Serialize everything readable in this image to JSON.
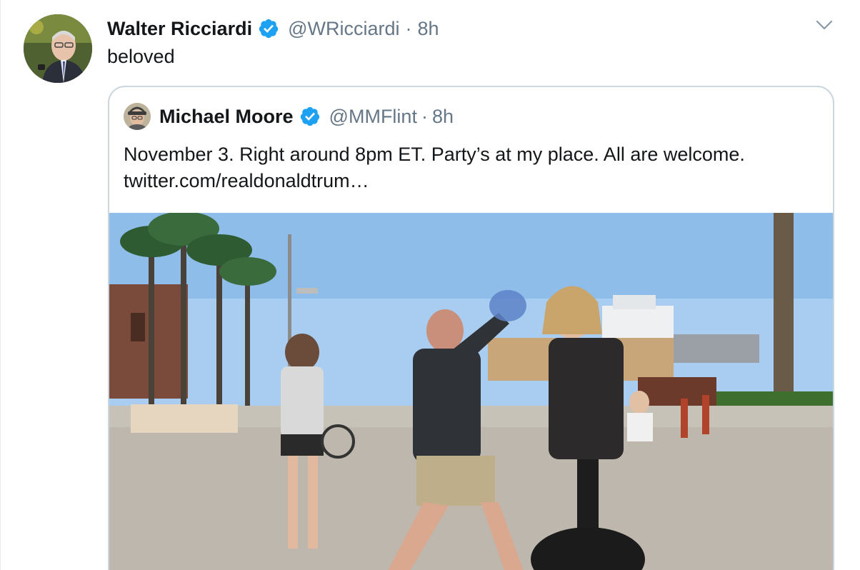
{
  "tweet": {
    "author_name": "Walter Ricciardi",
    "handle": "@WRicciardi",
    "separator": "·",
    "time": "8h",
    "text": "beloved",
    "icons": {
      "verified": "verified-badge-icon",
      "menu": "chevron-down-icon"
    }
  },
  "quoted_tweet": {
    "author_name": "Michael Moore",
    "handle": "@MMFlint",
    "separator": "·",
    "time": "8h",
    "text": "November 3.  Right around 8pm ET. Party’s at my place. All are welcome.",
    "link_text": "twitter.com/realdonaldtrum…",
    "media": "video-thumbnail-boardwalk"
  },
  "colors": {
    "text": "#14171a",
    "muted": "#657786",
    "verified": "#1da1f2",
    "border": "#ccd6dd"
  }
}
